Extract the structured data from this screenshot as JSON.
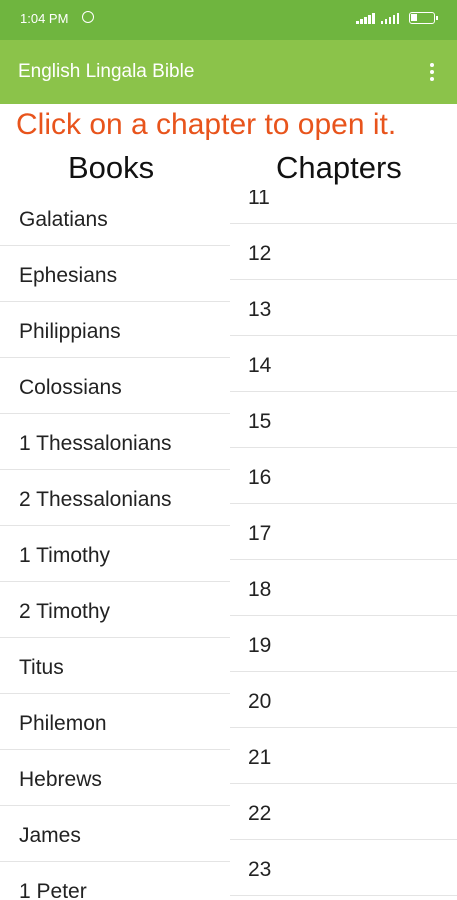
{
  "status": {
    "time": "1:04 PM"
  },
  "app": {
    "title": "English Lingala Bible"
  },
  "instruction": "Click on a chapter to open it.",
  "headers": {
    "books": "Books",
    "chapters": "Chapters"
  },
  "books": [
    "Galatians",
    "Ephesians",
    "Philippians",
    "Colossians",
    "1 Thessalonians",
    "2 Thessalonians",
    "1 Timothy",
    "2 Timothy",
    "Titus",
    "Philemon",
    "Hebrews",
    "James",
    "1 Peter"
  ],
  "chapters": [
    "11",
    "12",
    "13",
    "14",
    "15",
    "16",
    "17",
    "18",
    "19",
    "20",
    "21",
    "22",
    "23"
  ],
  "colors": {
    "statusbar": "#6fb53f",
    "appbar": "#8bc34a",
    "instruction": "#e8541c"
  }
}
